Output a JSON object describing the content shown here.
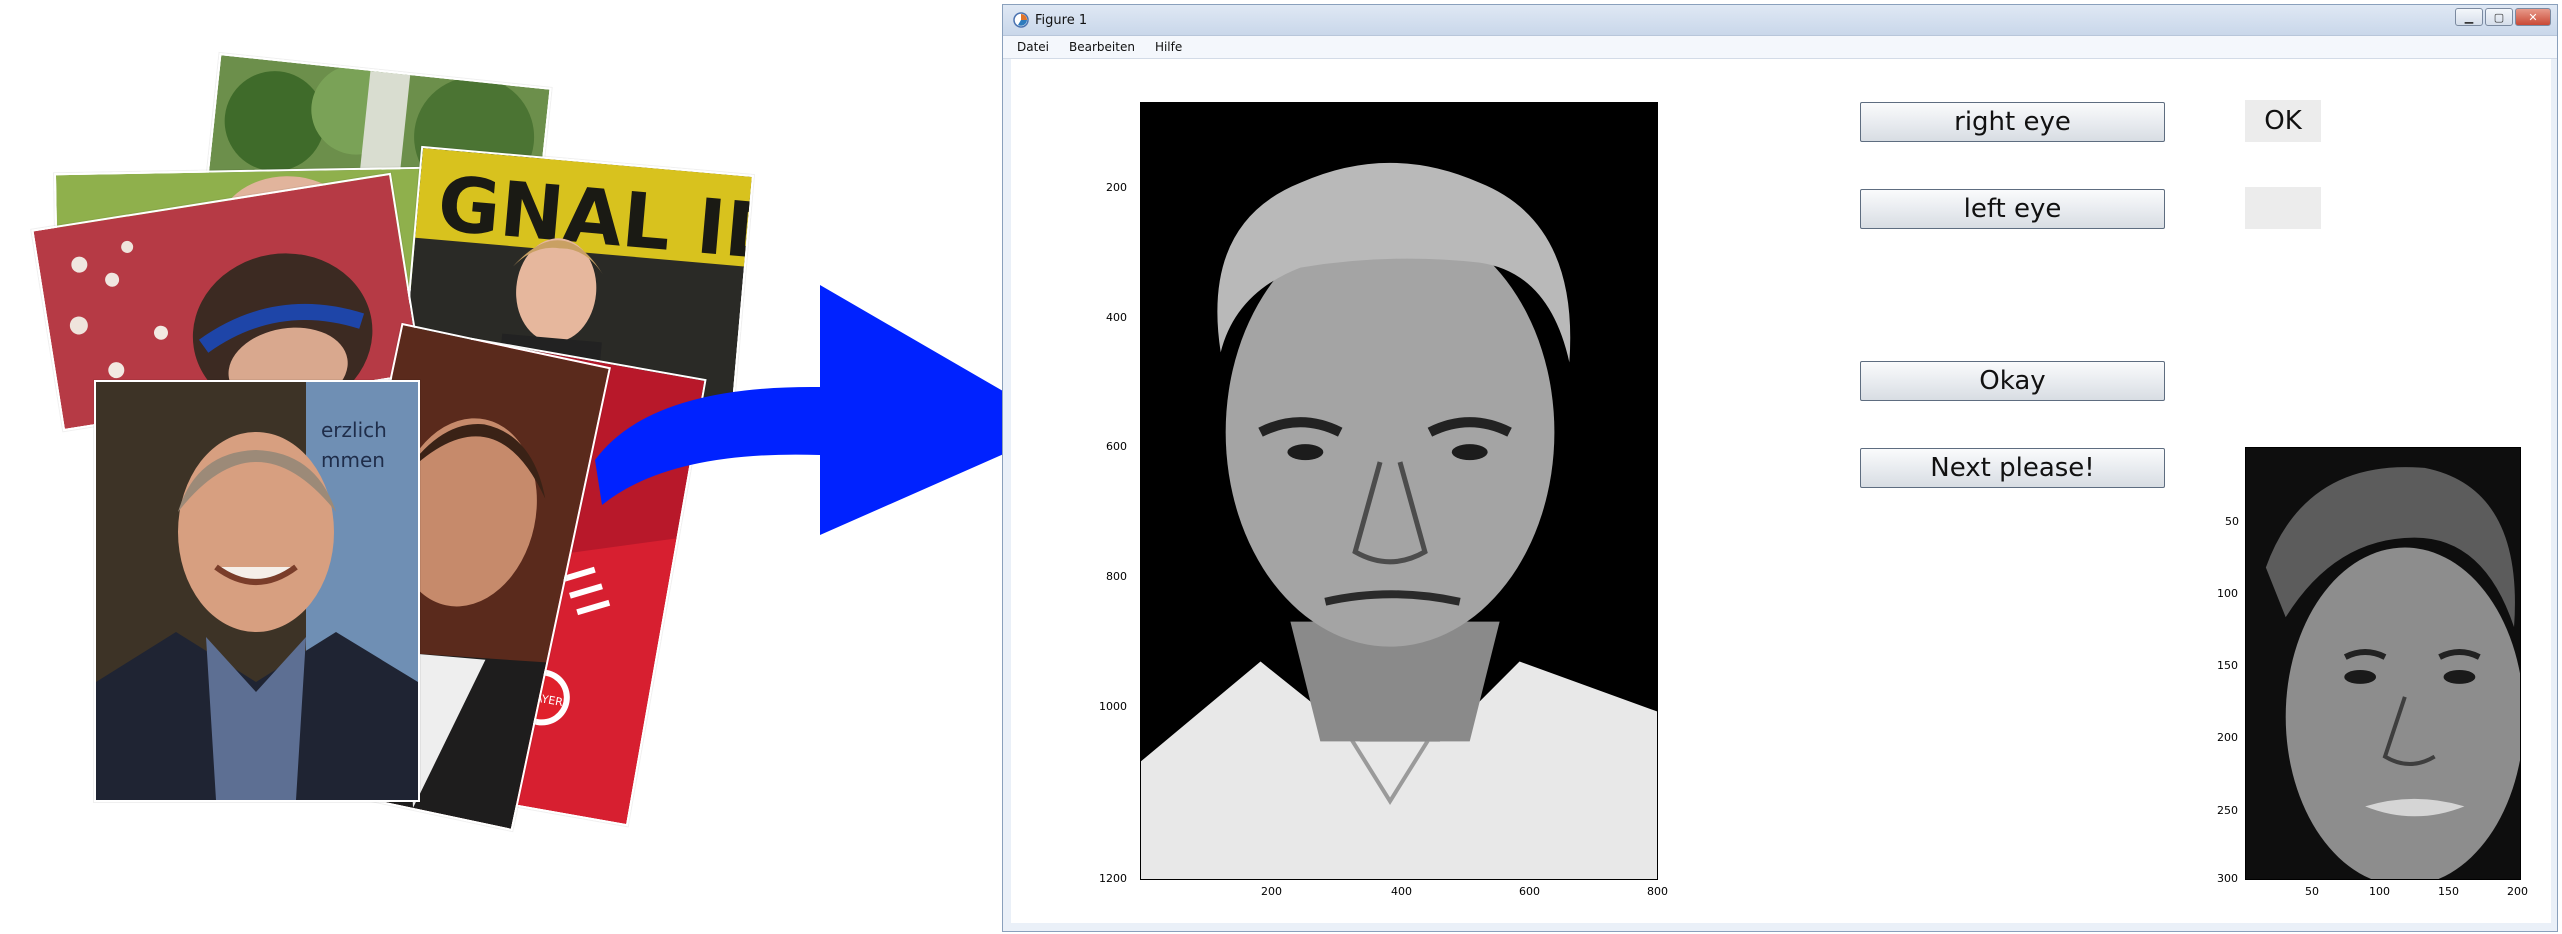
{
  "window": {
    "title": "Figure 1",
    "menu": [
      "Datei",
      "Bearbeiten",
      "Hilfe"
    ]
  },
  "buttons": {
    "right_eye": "right eye",
    "left_eye": "left eye",
    "okay": "Okay",
    "next": "Next please!"
  },
  "status": {
    "right_eye_status": "OK",
    "left_eye_status": ""
  },
  "main_plot": {
    "yticks": [
      "200",
      "400",
      "600",
      "800",
      "1000",
      "1200"
    ],
    "xticks": [
      "200",
      "400",
      "600",
      "800"
    ]
  },
  "preview_plot": {
    "yticks": [
      "50",
      "100",
      "150",
      "200",
      "250",
      "300"
    ],
    "xticks": [
      "50",
      "100",
      "150",
      "200"
    ]
  },
  "colors": {
    "arrow": "#0022ff",
    "window_frame": "#8aa0bc",
    "button_border": "#5e6d80"
  },
  "icons": {
    "app": "matplotlib-icon",
    "arrow": "right-arrow-icon"
  }
}
